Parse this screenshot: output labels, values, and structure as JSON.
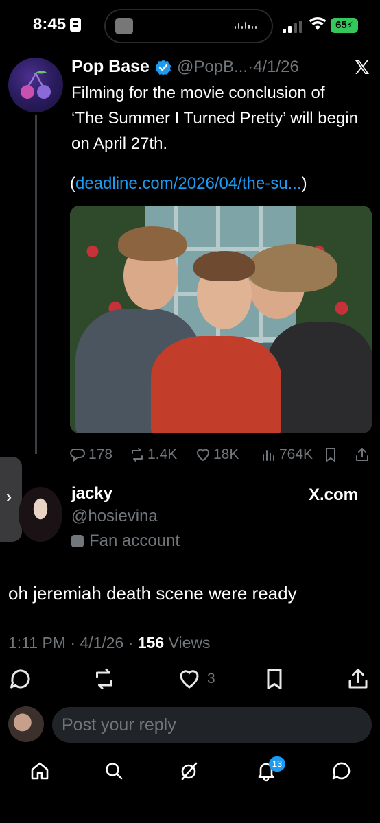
{
  "status_bar": {
    "time": "8:45",
    "battery": "65"
  },
  "parent_tweet": {
    "author_name": "Pop Base",
    "handle": "@PopB...",
    "separator": "·",
    "date": "4/1/26",
    "text": "Filming for the movie conclusion of ‘The Summer I Turned Pretty’ will begin on April 27th.",
    "link_open": "(",
    "link_url": "deadline.com/2026/04/the-su...",
    "link_close": ")",
    "stats": {
      "replies": "178",
      "reposts": "1.4K",
      "likes": "18K",
      "views": "764K"
    }
  },
  "reply_tweet": {
    "author_name": "jacky",
    "handle": "@hosievina",
    "badge_label": "Fan account",
    "source": "X.com",
    "text": "oh jeremiah death scene were ready",
    "time": "1:11 PM",
    "dot1": "·",
    "date": "4/1/26",
    "dot2": "·",
    "views_count": "156",
    "views_label": "Views",
    "likes": "3"
  },
  "side_tab": {
    "glyph": "›"
  },
  "composer": {
    "placeholder": "Post your reply"
  },
  "bottom_nav": {
    "notification_count": "13"
  },
  "colors": {
    "accent": "#1d9bf0",
    "muted": "#71767b",
    "background": "#000000",
    "battery": "#34c759"
  }
}
